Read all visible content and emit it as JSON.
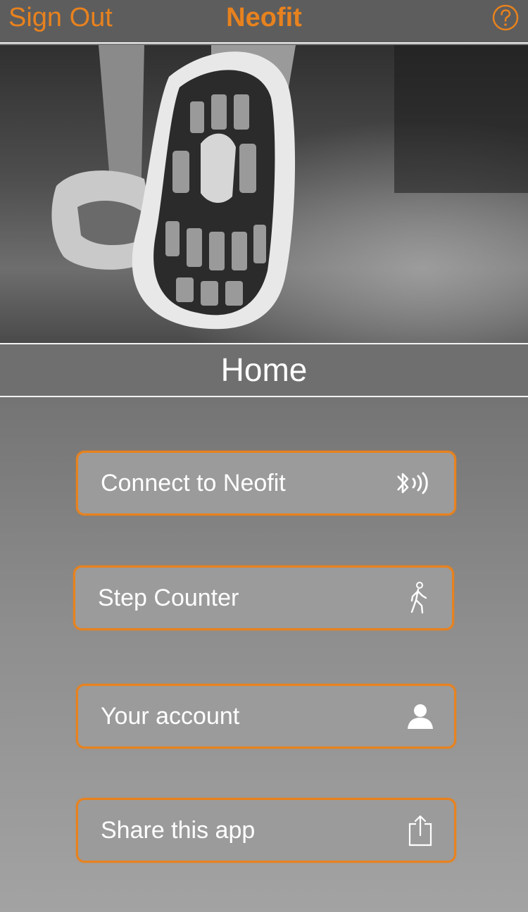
{
  "navbar": {
    "left_label": "Sign Out",
    "title": "Neofit",
    "help_icon": "question-circle-icon"
  },
  "hero": {
    "image": "running-shoe-photo"
  },
  "section": {
    "title": "Home"
  },
  "menu": {
    "items": [
      {
        "label": "Connect to Neofit",
        "icon": "bluetooth-signal-icon"
      },
      {
        "label": "Step Counter",
        "icon": "walking-person-icon"
      },
      {
        "label": "Your account",
        "icon": "user-icon"
      },
      {
        "label": "Share this app",
        "icon": "share-icon"
      }
    ]
  },
  "colors": {
    "accent": "#e8821e",
    "navbar_bg": "#5d5d5d",
    "button_bg": "#9b9b9b"
  }
}
